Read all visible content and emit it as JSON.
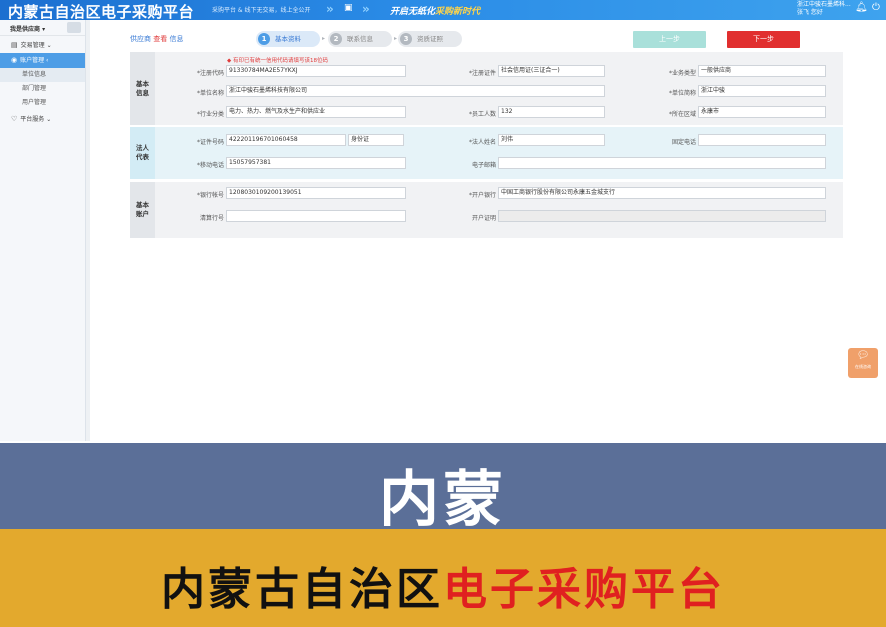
{
  "header": {
    "logo": "内蒙古自治区电子采购平台",
    "slogan_left": "采购平台 & 线下无交易，线上全公开",
    "slogan_right_prefix": "开启无纸化",
    "slogan_right_highlight": "采购新时代",
    "user_company": "浙江中骏石墨烯科...",
    "user_greeting": "张飞 您好"
  },
  "sidebar": {
    "role": "我是供应商",
    "items": [
      {
        "label": "交易管理",
        "icon": "document-icon"
      },
      {
        "label": "账户管理",
        "icon": "user-icon"
      },
      {
        "label": "平台服务",
        "icon": "heart-icon"
      }
    ],
    "subitems": [
      "单位信息",
      "部门管理",
      "用户管理"
    ]
  },
  "breadcrumb": {
    "prefix": "供应商",
    "highlight": "查看",
    "suffix": "信息"
  },
  "steps": [
    {
      "num": "1",
      "label": "基本资料"
    },
    {
      "num": "2",
      "label": "联系信息"
    },
    {
      "num": "3",
      "label": "资质证照"
    }
  ],
  "buttons": {
    "prev": "上一步",
    "next": "下一步"
  },
  "hint": "◆ 有印已有统一信用代码请填写该18位码",
  "sections": {
    "basic": "基本信息",
    "legal": "法人代表",
    "account": "基本账户"
  },
  "fields": {
    "credit_code_label": "*注册代码",
    "credit_code": "91330784MA2E57YKXJ",
    "reg_cert_label": "*注册证件",
    "reg_cert": "社会信用证(三证合一)",
    "biz_type_label": "*业务类型",
    "biz_type": "一般供应商",
    "unit_name_label": "*单位名称",
    "unit_name": "浙江中骏石墨烯科技有限公司",
    "unit_short_label": "*单位简称",
    "unit_short": "浙江中骏",
    "industry_label": "*行业分类",
    "industry": "电力、热力、燃气及水生产和供应业",
    "staff_label": "*员工人数",
    "staff": "132",
    "region_label": "*所在区域",
    "region": "永康市",
    "id_no_label": "*证件号码",
    "id_no": "422201196701060458",
    "id_type": "身份证",
    "legal_name_label": "*法人姓名",
    "legal_name": "刘伟",
    "tel_label": "固定电话",
    "tel": "",
    "mobile_label": "*移动电话",
    "mobile": "15057957381",
    "email_label": "电子邮箱",
    "email": "",
    "bank_acct_label": "*银行帐号",
    "bank_acct": "1208030109200139051",
    "bank_label": "*开户银行",
    "bank": "中国工商银行股份有限公司永康五金城支行",
    "clearing_label": "清算行号",
    "clearing": "",
    "bank_cert_label": "开户证明",
    "bank_cert": ""
  },
  "chat": {
    "label": "在线咨询"
  },
  "banner": {
    "title": "内蒙",
    "subtitle_black": "内蒙古自治区",
    "subtitle_red": "电子采购平台"
  },
  "colors": {
    "header": "#2a8be6",
    "accent": "#4d9de6",
    "next_button": "#e12f2f",
    "banner_blue": "#5b6f98",
    "banner_yellow": "#e3a92d"
  }
}
